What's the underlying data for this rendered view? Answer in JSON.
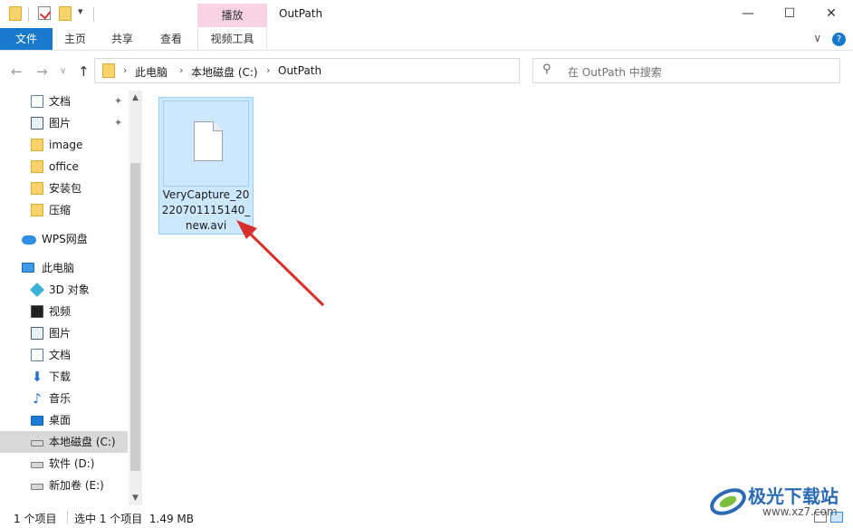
{
  "window": {
    "title": "OutPath",
    "context_tab_header": "播放",
    "minimize_glyph": "—",
    "maximize_glyph": "☐",
    "close_glyph": "✕"
  },
  "quick_access": {
    "dropdown_glyph": "▾"
  },
  "ribbon": {
    "tabs": [
      "文件",
      "主页",
      "共享",
      "查看",
      "视频工具"
    ],
    "expand_glyph": "∨",
    "help_glyph": "?"
  },
  "navigation": {
    "back_glyph": "←",
    "forward_glyph": "→",
    "recent_glyph": "∨",
    "up_glyph": "↑",
    "refresh_glyph": "↻",
    "dropdown_glyph": "∨",
    "crumb_separator": "›",
    "breadcrumbs": [
      "此电脑",
      "本地磁盘 (C:)",
      "OutPath"
    ]
  },
  "search": {
    "placeholder": "在 OutPath 中搜索",
    "icon": "search-icon",
    "icon_glyph": "⚲"
  },
  "sidebar": {
    "pin_glyph": "✦",
    "items": [
      {
        "label": "文档",
        "icon": "document-icon",
        "pinned": true
      },
      {
        "label": "图片",
        "icon": "pictures-icon",
        "pinned": true
      },
      {
        "label": "image",
        "icon": "folder-icon"
      },
      {
        "label": "office",
        "icon": "folder-icon"
      },
      {
        "label": "安装包",
        "icon": "folder-icon"
      },
      {
        "label": "压缩",
        "icon": "folder-icon"
      },
      {
        "label": "WPS网盘",
        "icon": "cloud-icon"
      },
      {
        "label": "此电脑",
        "icon": "computer-icon"
      },
      {
        "label": "3D 对象",
        "icon": "3d-objects-icon"
      },
      {
        "label": "视频",
        "icon": "video-icon"
      },
      {
        "label": "图片",
        "icon": "pictures-icon"
      },
      {
        "label": "文档",
        "icon": "document-icon"
      },
      {
        "label": "下载",
        "icon": "download-icon",
        "glyph": "⬇"
      },
      {
        "label": "音乐",
        "icon": "music-icon",
        "glyph": "♪"
      },
      {
        "label": "桌面",
        "icon": "desktop-icon"
      },
      {
        "label": "本地磁盘 (C:)",
        "icon": "drive-icon",
        "selected": true
      },
      {
        "label": "软件 (D:)",
        "icon": "drive-icon"
      },
      {
        "label": "新加卷 (E:)",
        "icon": "drive-icon"
      }
    ],
    "scroll_up_glyph": "▲",
    "scroll_down_glyph": "▼"
  },
  "files": [
    {
      "name": "VeryCapture_20220701115140_new.avi",
      "selected": true
    }
  ],
  "status": {
    "item_count": "1 个项目",
    "selection": "选中 1 个项目  1.49 MB"
  },
  "watermark": {
    "title": "极光下载站",
    "url": "www.xz7.com"
  },
  "colors": {
    "accent": "#1979ca",
    "selection_fill": "#cce8ff",
    "arrow": "#d8312c"
  }
}
